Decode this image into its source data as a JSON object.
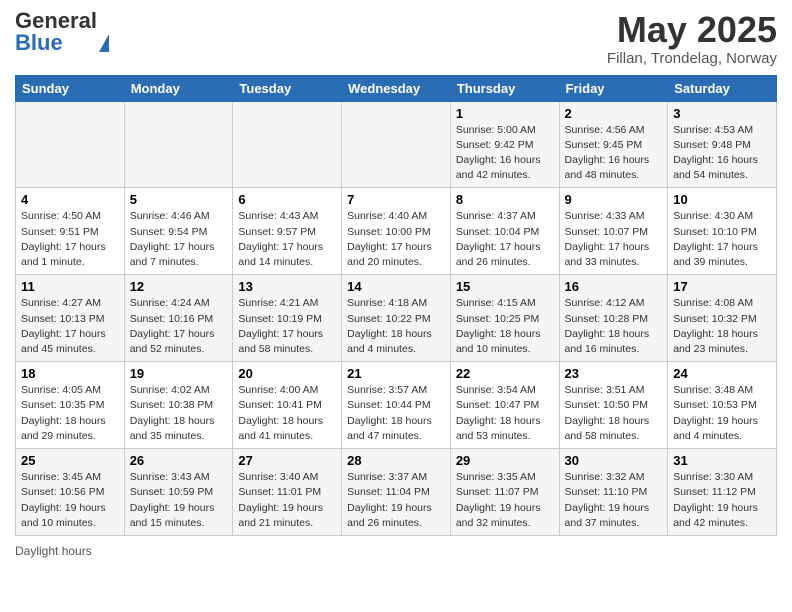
{
  "header": {
    "logo_general": "General",
    "logo_blue": "Blue",
    "month": "May 2025",
    "location": "Fillan, Trondelag, Norway"
  },
  "days_of_week": [
    "Sunday",
    "Monday",
    "Tuesday",
    "Wednesday",
    "Thursday",
    "Friday",
    "Saturday"
  ],
  "weeks": [
    [
      {
        "day": "",
        "info": ""
      },
      {
        "day": "",
        "info": ""
      },
      {
        "day": "",
        "info": ""
      },
      {
        "day": "",
        "info": ""
      },
      {
        "day": "1",
        "info": "Sunrise: 5:00 AM\nSunset: 9:42 PM\nDaylight: 16 hours and 42 minutes."
      },
      {
        "day": "2",
        "info": "Sunrise: 4:56 AM\nSunset: 9:45 PM\nDaylight: 16 hours and 48 minutes."
      },
      {
        "day": "3",
        "info": "Sunrise: 4:53 AM\nSunset: 9:48 PM\nDaylight: 16 hours and 54 minutes."
      }
    ],
    [
      {
        "day": "4",
        "info": "Sunrise: 4:50 AM\nSunset: 9:51 PM\nDaylight: 17 hours and 1 minute."
      },
      {
        "day": "5",
        "info": "Sunrise: 4:46 AM\nSunset: 9:54 PM\nDaylight: 17 hours and 7 minutes."
      },
      {
        "day": "6",
        "info": "Sunrise: 4:43 AM\nSunset: 9:57 PM\nDaylight: 17 hours and 14 minutes."
      },
      {
        "day": "7",
        "info": "Sunrise: 4:40 AM\nSunset: 10:00 PM\nDaylight: 17 hours and 20 minutes."
      },
      {
        "day": "8",
        "info": "Sunrise: 4:37 AM\nSunset: 10:04 PM\nDaylight: 17 hours and 26 minutes."
      },
      {
        "day": "9",
        "info": "Sunrise: 4:33 AM\nSunset: 10:07 PM\nDaylight: 17 hours and 33 minutes."
      },
      {
        "day": "10",
        "info": "Sunrise: 4:30 AM\nSunset: 10:10 PM\nDaylight: 17 hours and 39 minutes."
      }
    ],
    [
      {
        "day": "11",
        "info": "Sunrise: 4:27 AM\nSunset: 10:13 PM\nDaylight: 17 hours and 45 minutes."
      },
      {
        "day": "12",
        "info": "Sunrise: 4:24 AM\nSunset: 10:16 PM\nDaylight: 17 hours and 52 minutes."
      },
      {
        "day": "13",
        "info": "Sunrise: 4:21 AM\nSunset: 10:19 PM\nDaylight: 17 hours and 58 minutes."
      },
      {
        "day": "14",
        "info": "Sunrise: 4:18 AM\nSunset: 10:22 PM\nDaylight: 18 hours and 4 minutes."
      },
      {
        "day": "15",
        "info": "Sunrise: 4:15 AM\nSunset: 10:25 PM\nDaylight: 18 hours and 10 minutes."
      },
      {
        "day": "16",
        "info": "Sunrise: 4:12 AM\nSunset: 10:28 PM\nDaylight: 18 hours and 16 minutes."
      },
      {
        "day": "17",
        "info": "Sunrise: 4:08 AM\nSunset: 10:32 PM\nDaylight: 18 hours and 23 minutes."
      }
    ],
    [
      {
        "day": "18",
        "info": "Sunrise: 4:05 AM\nSunset: 10:35 PM\nDaylight: 18 hours and 29 minutes."
      },
      {
        "day": "19",
        "info": "Sunrise: 4:02 AM\nSunset: 10:38 PM\nDaylight: 18 hours and 35 minutes."
      },
      {
        "day": "20",
        "info": "Sunrise: 4:00 AM\nSunset: 10:41 PM\nDaylight: 18 hours and 41 minutes."
      },
      {
        "day": "21",
        "info": "Sunrise: 3:57 AM\nSunset: 10:44 PM\nDaylight: 18 hours and 47 minutes."
      },
      {
        "day": "22",
        "info": "Sunrise: 3:54 AM\nSunset: 10:47 PM\nDaylight: 18 hours and 53 minutes."
      },
      {
        "day": "23",
        "info": "Sunrise: 3:51 AM\nSunset: 10:50 PM\nDaylight: 18 hours and 58 minutes."
      },
      {
        "day": "24",
        "info": "Sunrise: 3:48 AM\nSunset: 10:53 PM\nDaylight: 19 hours and 4 minutes."
      }
    ],
    [
      {
        "day": "25",
        "info": "Sunrise: 3:45 AM\nSunset: 10:56 PM\nDaylight: 19 hours and 10 minutes."
      },
      {
        "day": "26",
        "info": "Sunrise: 3:43 AM\nSunset: 10:59 PM\nDaylight: 19 hours and 15 minutes."
      },
      {
        "day": "27",
        "info": "Sunrise: 3:40 AM\nSunset: 11:01 PM\nDaylight: 19 hours and 21 minutes."
      },
      {
        "day": "28",
        "info": "Sunrise: 3:37 AM\nSunset: 11:04 PM\nDaylight: 19 hours and 26 minutes."
      },
      {
        "day": "29",
        "info": "Sunrise: 3:35 AM\nSunset: 11:07 PM\nDaylight: 19 hours and 32 minutes."
      },
      {
        "day": "30",
        "info": "Sunrise: 3:32 AM\nSunset: 11:10 PM\nDaylight: 19 hours and 37 minutes."
      },
      {
        "day": "31",
        "info": "Sunrise: 3:30 AM\nSunset: 11:12 PM\nDaylight: 19 hours and 42 minutes."
      }
    ]
  ],
  "footer": {
    "daylight_label": "Daylight hours"
  }
}
